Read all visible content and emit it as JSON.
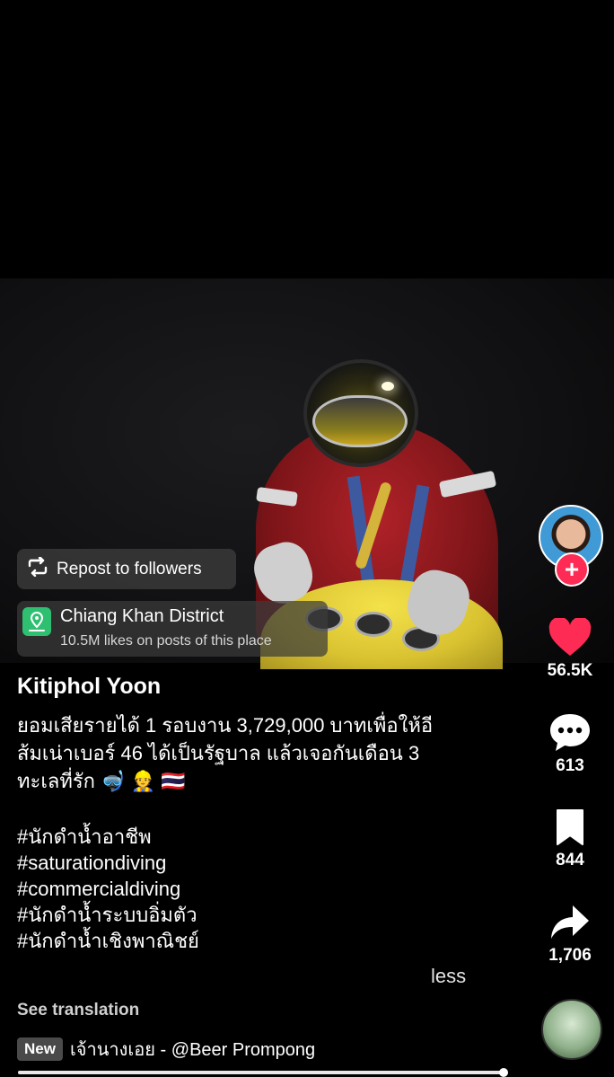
{
  "video": {
    "repost_label": "Repost to followers",
    "location_name": "Chiang Khan District",
    "location_sub": "10.5M likes on posts of this place"
  },
  "actions": {
    "likes": "56.5K",
    "comments": "613",
    "saves": "844",
    "shares": "1,706",
    "follow_symbol": "+"
  },
  "post": {
    "author": "Kitiphol Yoon",
    "caption_line1": "ยอมเสียรายได้ 1 รอบงาน 3,729,000 บาทเพื่อให้อี",
    "caption_line2": "ส้มเน่าเบอร์ 46 ได้เป็นรัฐบาล แล้วเจอกันเดือน 3",
    "caption_line3": "ทะเลที่รัก 🤿 👷 🇹🇭",
    "hashtags": [
      "#นักดำน้ำอาชีพ",
      "#saturationdiving",
      "#commercialdiving",
      "#นักดำน้ำระบบอิ่มตัว",
      "#นักดำน้ำเชิงพาณิชย์"
    ],
    "less_label": "less",
    "see_translation": "See translation"
  },
  "music": {
    "badge": "New",
    "title": "เจ้านางเอย - @Beer Prompong"
  },
  "playback": {
    "progress_fraction": 0.99
  },
  "colors": {
    "like_red": "#fe2c55",
    "location_green": "#2fbf71",
    "background": "#000000"
  }
}
